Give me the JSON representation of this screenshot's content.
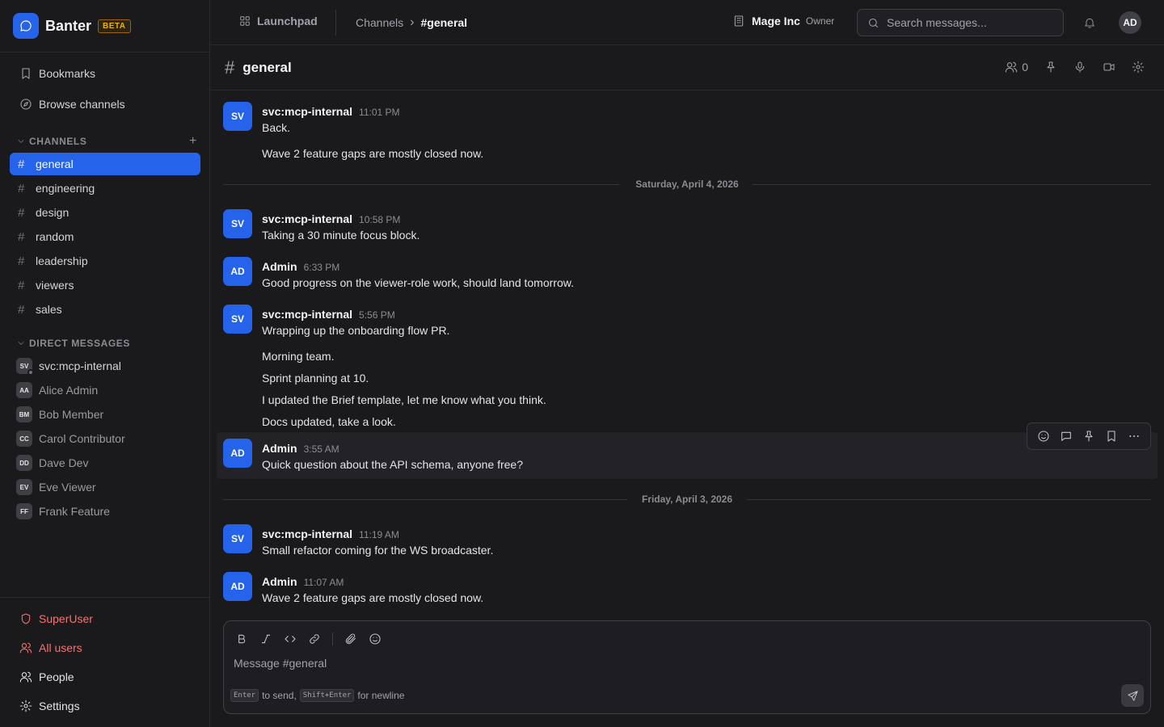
{
  "app": {
    "name": "Banter",
    "badge": "BETA"
  },
  "sidebar": {
    "links": [
      {
        "label": "Bookmarks",
        "icon": "bookmark-icon"
      },
      {
        "label": "Browse channels",
        "icon": "compass-icon"
      }
    ],
    "channels_heading": "CHANNELS",
    "channels": [
      {
        "name": "general",
        "active": true
      },
      {
        "name": "engineering",
        "active": false
      },
      {
        "name": "design",
        "active": false
      },
      {
        "name": "random",
        "active": false
      },
      {
        "name": "leadership",
        "active": false
      },
      {
        "name": "viewers",
        "active": false
      },
      {
        "name": "sales",
        "active": false
      }
    ],
    "dm_heading": "DIRECT MESSAGES",
    "dms": [
      {
        "initials": "SV",
        "name": "svc:mcp-internal"
      },
      {
        "initials": "AA",
        "name": "Alice Admin"
      },
      {
        "initials": "BM",
        "name": "Bob Member"
      },
      {
        "initials": "CC",
        "name": "Carol Contributor"
      },
      {
        "initials": "DD",
        "name": "Dave Dev"
      },
      {
        "initials": "EV",
        "name": "Eve Viewer"
      },
      {
        "initials": "FF",
        "name": "Frank Feature"
      }
    ],
    "bottom": [
      {
        "label": "SuperUser",
        "icon": "shield-icon"
      },
      {
        "label": "All users",
        "icon": "users-icon"
      },
      {
        "label": "People",
        "icon": "people-icon"
      },
      {
        "label": "Settings",
        "icon": "gear-icon"
      }
    ]
  },
  "topbar": {
    "launchpad": "Launchpad",
    "breadcrumb": [
      "Channels",
      "#general"
    ],
    "org_name": "Mage Inc",
    "org_role": "Owner",
    "search_placeholder": "Search messages...",
    "user_initials": "AD"
  },
  "channel": {
    "name": "general",
    "member_count": "0"
  },
  "messages": [
    {
      "initials": "SV",
      "author": "svc:mcp-internal",
      "time": "11:01 PM",
      "lines": [
        "Back.",
        "Wave 2 feature gaps are mostly closed now."
      ]
    },
    {
      "divider": "Saturday, April 4, 2026"
    },
    {
      "initials": "SV",
      "author": "svc:mcp-internal",
      "time": "10:58 PM",
      "lines": [
        "Taking a 30 minute focus block."
      ]
    },
    {
      "initials": "AD",
      "author": "Admin",
      "time": "6:33 PM",
      "lines": [
        "Good progress on the viewer-role work, should land tomorrow."
      ]
    },
    {
      "initials": "SV",
      "author": "svc:mcp-internal",
      "time": "5:56 PM",
      "lines": [
        "Wrapping up the onboarding flow PR.",
        "Morning team.",
        "Sprint planning at 10.",
        "I updated the Brief template, let me know what you think.",
        "Docs updated, take a look."
      ]
    },
    {
      "initials": "AD",
      "author": "Admin",
      "time": "3:55 AM",
      "lines": [
        "Quick question about the API schema, anyone free?"
      ]
    },
    {
      "divider": "Friday, April 3, 2026"
    },
    {
      "initials": "SV",
      "author": "svc:mcp-internal",
      "time": "11:19 AM",
      "lines": [
        "Small refactor coming for the WS broadcaster."
      ]
    },
    {
      "initials": "AD",
      "author": "Admin",
      "time": "11:07 AM",
      "lines": [
        "Wave 2 feature gaps are mostly closed now."
      ]
    }
  ],
  "composer": {
    "placeholder": "Message #general",
    "hint_key1": "Enter",
    "hint_text1": "to send,",
    "hint_key2": "Shift+Enter",
    "hint_text2": "for newline"
  },
  "colors": {
    "accent": "#2563eb",
    "danger": "#f87171",
    "beta": "#eab308"
  }
}
